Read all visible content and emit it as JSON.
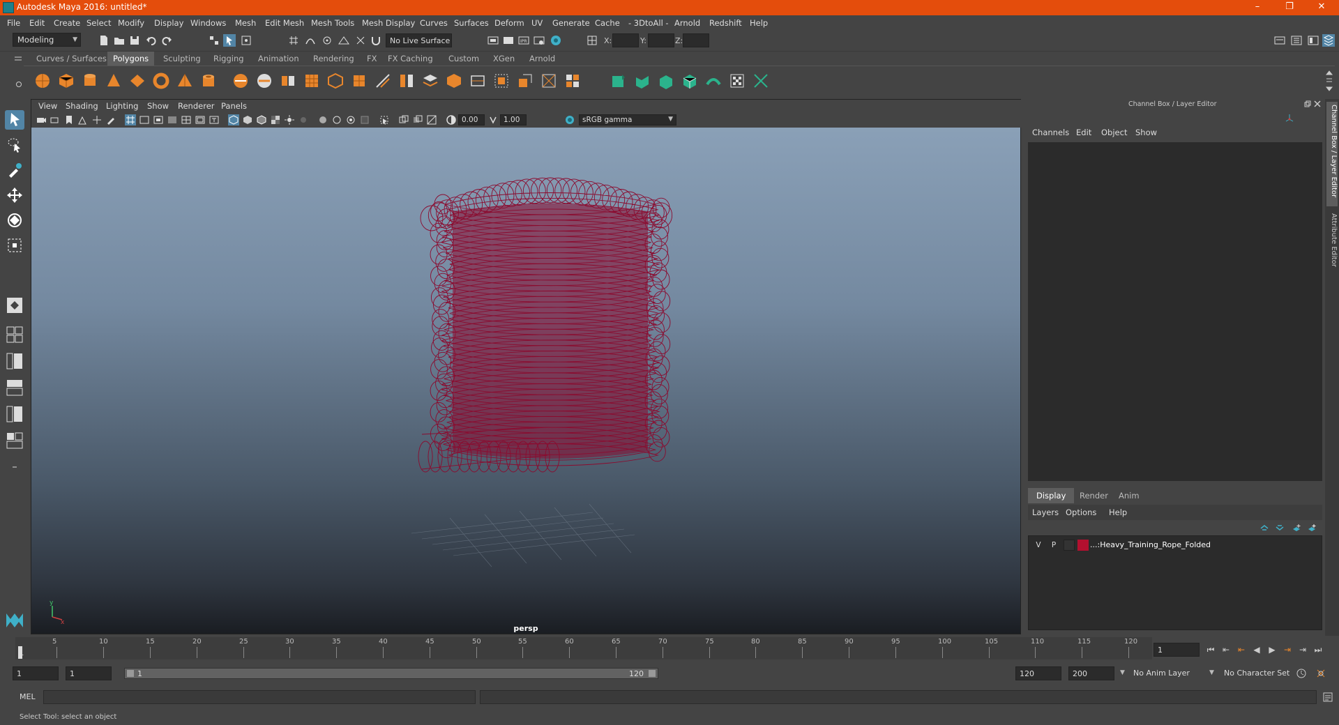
{
  "window": {
    "title": "Autodesk Maya 2016: untitled*",
    "controls": [
      "–",
      "❐",
      "✕"
    ]
  },
  "menubar": {
    "items": [
      "File",
      "Edit",
      "Create",
      "Select",
      "Modify",
      "Display",
      "Windows",
      "Mesh",
      "Edit Mesh",
      "Mesh Tools",
      "Mesh Display",
      "Curves",
      "Surfaces",
      "Deform",
      "UV",
      "Generate",
      "Cache",
      "- 3DtoAll -",
      "Arnold",
      "Redshift",
      "Help"
    ]
  },
  "statusline": {
    "mode": "Modeling",
    "live_surface": "No Live Surface",
    "x_label": "X:",
    "y_label": "Y:",
    "z_label": "Z:"
  },
  "shelf": {
    "tabs": [
      "Curves / Surfaces",
      "Polygons",
      "Sculpting",
      "Rigging",
      "Animation",
      "Rendering",
      "FX",
      "FX Caching",
      "Custom",
      "XGen",
      "Arnold"
    ],
    "active_tab": "Polygons"
  },
  "viewport": {
    "menu": [
      "View",
      "Shading",
      "Lighting",
      "Show",
      "Renderer",
      "Panels"
    ],
    "exposure": "0.00",
    "gamma": "1.00",
    "color_space": "sRGB gamma",
    "camera_label": "persp",
    "wireframe_color": "#8b0a2e"
  },
  "channel_box": {
    "title": "Channel Box / Layer Editor",
    "menu": [
      "Channels",
      "Edit",
      "Object",
      "Show"
    ]
  },
  "layer_editor": {
    "tabs": [
      "Display",
      "Render",
      "Anim"
    ],
    "active_tab": "Display",
    "menu": [
      "Layers",
      "Options",
      "Help"
    ],
    "layers": [
      {
        "visible": "V",
        "playback": "P",
        "color": "#b3102f",
        "name": "...:Heavy_Training_Rope_Folded"
      }
    ]
  },
  "side_tabs": [
    "Channel Box / Layer Editor",
    "Attribute Editor"
  ],
  "time_slider": {
    "ticks": [
      "5",
      "10",
      "15",
      "20",
      "25",
      "30",
      "35",
      "40",
      "45",
      "50",
      "55",
      "60",
      "65",
      "70",
      "75",
      "80",
      "85",
      "90",
      "95",
      "100",
      "105",
      "110",
      "115",
      "120"
    ],
    "current_frame_label": "1",
    "current_frame": "1"
  },
  "range_slider": {
    "start": "1",
    "playback_start": "1",
    "bar_start": "1",
    "bar_end": "120",
    "playback_end": "120",
    "end": "200",
    "anim_layer": "No Anim Layer",
    "character_set": "No Character Set"
  },
  "command_line": {
    "label": "MEL"
  },
  "help_line": {
    "text": "Select Tool: select an object"
  }
}
